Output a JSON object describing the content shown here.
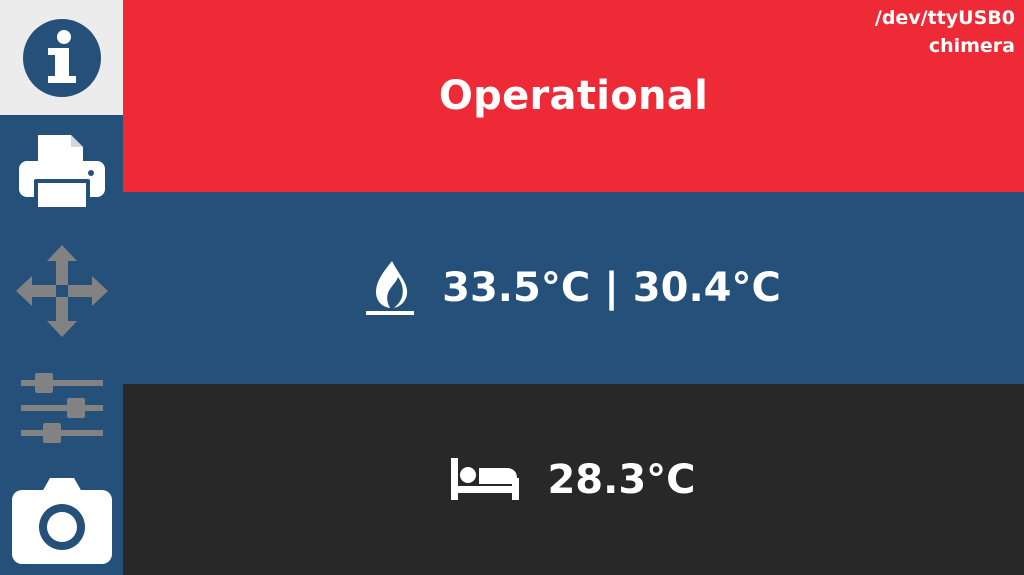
{
  "connection": {
    "port": "/dev/ttyUSB0",
    "profile": "chimera"
  },
  "status": {
    "text": "Operational",
    "color": "#ee2a37"
  },
  "hotend": {
    "icon": "flame-icon",
    "temp_actual": "33.5°C",
    "separator": "|",
    "temp_second": "30.4°C",
    "color": "#24507a"
  },
  "bed": {
    "icon": "bed-icon",
    "temp": "28.3°C",
    "color": "#282828"
  },
  "sidebar": {
    "items": [
      {
        "name": "info",
        "icon": "info-icon",
        "active": true
      },
      {
        "name": "print",
        "icon": "printer-icon",
        "active": false
      },
      {
        "name": "move",
        "icon": "move-arrows-icon",
        "active": false
      },
      {
        "name": "settings",
        "icon": "sliders-icon",
        "active": false
      },
      {
        "name": "webcam",
        "icon": "camera-icon",
        "active": false
      }
    ]
  }
}
